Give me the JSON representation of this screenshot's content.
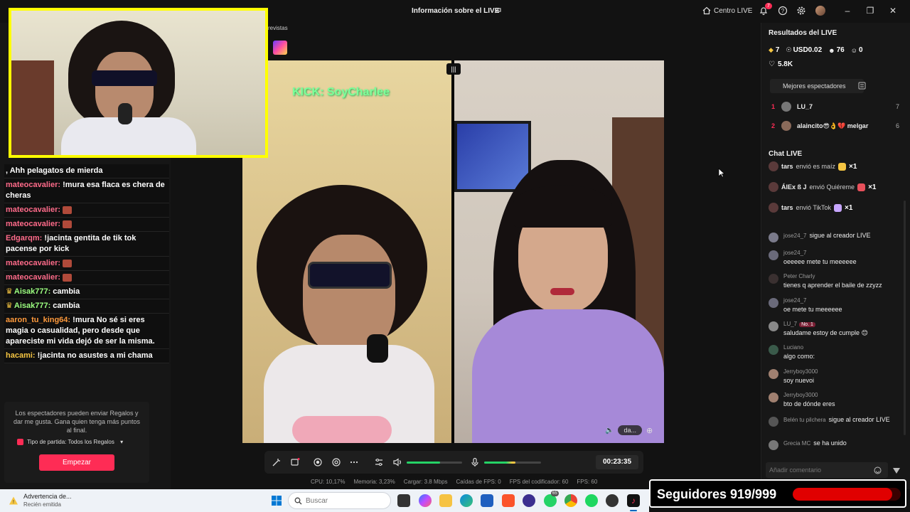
{
  "window": {
    "title": "Información sobre el LIVE",
    "centro_label": "Centro LIVE",
    "notif_count": "7"
  },
  "stream": {
    "tag": "revistas",
    "kick_overlay": "KICK: SoyCharlee",
    "pane_b_label": "da...",
    "timer": "00:23:35",
    "mic_level": 0.55,
    "speaker_level": 0.6
  },
  "chat_overlay": [
    {
      "user": "",
      "text": ", Ahh pelagatos de mierda",
      "cls": ""
    },
    {
      "user": "mateocavalier:",
      "text": " !mura esa flaca es chera de cheras",
      "cls": ""
    },
    {
      "user": "mateocavalier:",
      "text": "",
      "cls": "",
      "emote": true
    },
    {
      "user": "mateocavalier:",
      "text": "",
      "cls": "",
      "emote": true
    },
    {
      "user": "Edgarqm:",
      "text": " !jacinta gentita de tik tok pacense por kick",
      "cls": ""
    },
    {
      "user": "mateocavalier:",
      "text": "",
      "cls": "",
      "emote": true
    },
    {
      "user": "mateocavalier:",
      "text": "",
      "cls": "",
      "emote": true
    },
    {
      "user": "Aisak777:",
      "text": " cambia",
      "cls": "green"
    },
    {
      "user": "Aisak777:",
      "text": " cambia",
      "cls": "green"
    },
    {
      "user": "aaron_tu_king64:",
      "text": " !mura No sé si eres magia o casualidad, pero desde que apareciste mi vida dejó de ser la misma.",
      "cls": "orange"
    },
    {
      "user": "hacami:",
      "text": " !jacinta no asustes a mi chama",
      "cls": "gold"
    }
  ],
  "battle": {
    "description": "Los espectadores pueden enviar Regalos y dar me gusta. Gana quien tenga más puntos al final.",
    "type_label": "Tipo de partida: Todos los Regalos",
    "start_label": "Empezar"
  },
  "stats_bar": {
    "cpu": "CPU: 10,17%",
    "memory": "Memoria: 3,23%",
    "upload": "Cargar: 3.8 Mbps",
    "fps_drops": "Caídas de FPS: 0",
    "encoder_fps": "FPS del codificador: 60",
    "fps": "FPS: 60"
  },
  "results": {
    "heading": "Resultados del LIVE",
    "diamonds": "7",
    "earnings": "USD0.02",
    "viewers": "76",
    "new_followers": "0",
    "likes": "5.8K"
  },
  "best_viewers": {
    "button_label": "Mejores espectadores",
    "items": [
      {
        "rank": "1",
        "name": "LU_7",
        "count": "7"
      },
      {
        "rank": "2",
        "name": "alaincito😎👌💔 melgar",
        "count": "6"
      }
    ]
  },
  "live_chat": {
    "heading": "Chat LIVE",
    "gifts": [
      {
        "user": "tars",
        "action": "envió es maíz",
        "mult": "×1"
      },
      {
        "user": "ÁlEx ß J",
        "action": "envió Quiéreme",
        "mult": "×1"
      },
      {
        "user": "tars",
        "action": "envió TikTok",
        "mult": "×1"
      }
    ],
    "messages": [
      {
        "user": "jose24_7",
        "text": "sigue al creador LIVE",
        "inline": true
      },
      {
        "user": "jose24_7",
        "text": "oeeeee mete tu meeeeee"
      },
      {
        "user": "Peter Charly",
        "text": "tienes q aprender el baile de zzyzz"
      },
      {
        "user": "jose24_7",
        "text": "oe mete tu meeeeee"
      },
      {
        "user": "LU_7",
        "text": "saludame estoy de cumple 😊",
        "badge": "No. 1"
      },
      {
        "user": "Luciano",
        "text": "algo como:"
      },
      {
        "user": "Jerryboy3000",
        "text": "soy nuevoi"
      },
      {
        "user": "Jerryboy3000",
        "text": "bto de dónde eres"
      },
      {
        "user": "Belén tu pilchera",
        "text": "sigue al creador LIVE",
        "inline": true
      },
      {
        "user": "Grecia MC",
        "text": "se ha unido",
        "inline": true
      }
    ],
    "input_placeholder": "Añadir comentario"
  },
  "follower_goal": {
    "label": "Seguidores 919/999",
    "current": 919,
    "target": 999
  },
  "taskbar": {
    "toast_title": "Advertencia de...",
    "toast_sub": "Recién emitida",
    "search_placeholder": "Buscar",
    "whatsapp_badge": "65"
  },
  "colors": {
    "accent": "#fe2c55",
    "webcam_border": "#ffff00",
    "kick_green": "#7dff9a",
    "volume": "#25d366",
    "follower_bar": "#e00000"
  }
}
